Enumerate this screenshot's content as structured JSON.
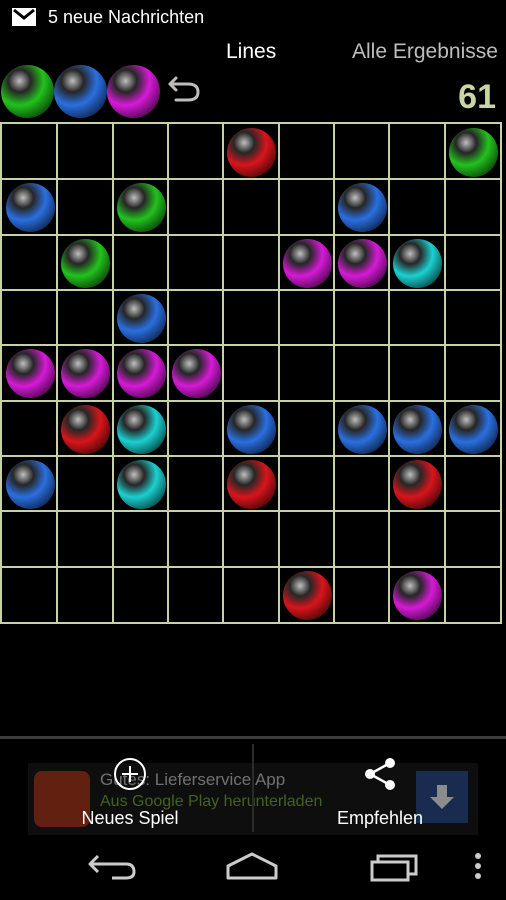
{
  "status": {
    "notification_text": "5 neue Nachrichten",
    "icon": "gmail-icon"
  },
  "tabs": {
    "lines_label": "Lines",
    "all_results_label": "Alle Ergebnisse"
  },
  "game": {
    "score": "61",
    "next_balls": [
      "green",
      "blue",
      "magenta"
    ],
    "colors": {
      "red": "#d8151b",
      "green": "#22c21d",
      "blue": "#2a6fe0",
      "magenta": "#d61ad6",
      "cyan": "#1bd0d0"
    },
    "board": [
      [
        null,
        null,
        null,
        null,
        "red",
        null,
        null,
        null,
        "green"
      ],
      [
        "blue",
        null,
        "green",
        null,
        null,
        null,
        "blue",
        null,
        null
      ],
      [
        null,
        "green",
        null,
        null,
        null,
        "magenta",
        "magenta",
        "cyan",
        null
      ],
      [
        null,
        null,
        "blue",
        null,
        null,
        null,
        null,
        null,
        null
      ],
      [
        "magenta",
        "magenta",
        "magenta",
        "magenta",
        null,
        null,
        null,
        null,
        null
      ],
      [
        null,
        "red",
        "cyan",
        null,
        "blue",
        null,
        "blue",
        "blue",
        "blue"
      ],
      [
        "blue",
        null,
        "cyan",
        null,
        "red",
        null,
        null,
        "red",
        null
      ],
      [
        null,
        null,
        null,
        null,
        null,
        null,
        null,
        null,
        null
      ],
      [
        null,
        null,
        null,
        null,
        null,
        "red",
        null,
        "magenta",
        null
      ]
    ]
  },
  "actions": {
    "new_game_label": "Neues Spiel",
    "share_label": "Empfehlen"
  },
  "ad": {
    "title": "Gutes: Lieferservice App",
    "subtitle": "Aus Google Play herunterladen"
  },
  "navbar": {
    "back": "back-icon",
    "home": "home-icon",
    "recents": "recents-icon",
    "menu": "overflow-menu-icon"
  }
}
